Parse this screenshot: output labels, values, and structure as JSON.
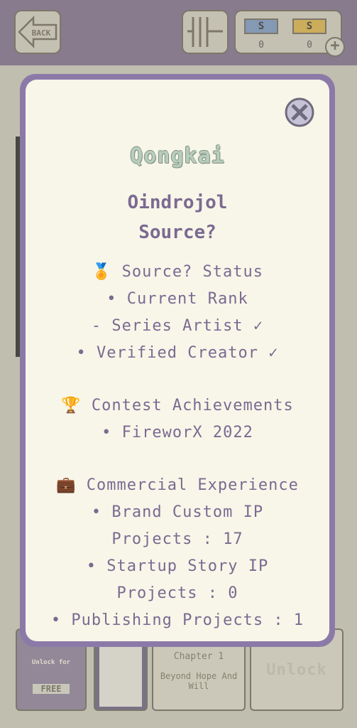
{
  "header": {
    "back_label": "BACK",
    "currency_blue_symbol": "S",
    "currency_gold_symbol": "S",
    "currency_blue_count": "0",
    "currency_gold_count": "0",
    "plus_label": "+"
  },
  "background": {
    "free_card_label": "Unlock for",
    "free_card_word": "FREE",
    "chapter_title": "Chapter 1",
    "chapter_subtitle": "Beyond Hope And Will",
    "unlock_label": "Unlock"
  },
  "modal": {
    "brand": "Qongkai",
    "title_line1": "Oindrojol",
    "title_line2": "Source?",
    "status_header": "🏅 Source? Status",
    "current_rank": "• Current Rank",
    "series_artist": "- Series Artist ✓",
    "verified_creator": "• Verified Creator ✓",
    "contest_header": "🏆 Contest Achievements",
    "contest_item": "• FireworX 2022",
    "commercial_header": "💼 Commercial Experience",
    "brand_ip_line1": "• Brand Custom IP",
    "brand_ip_line2": "Projects : 17",
    "startup_ip_line1": "• Startup Story IP",
    "startup_ip_line2": "Projects : 0",
    "publishing": "• Publishing Projects : 1"
  },
  "colors": {
    "top_bar": "#7e6f8e",
    "modal_border": "#8b7aa8",
    "modal_bg": "#f8f6e8",
    "text": "#7a6a92"
  }
}
